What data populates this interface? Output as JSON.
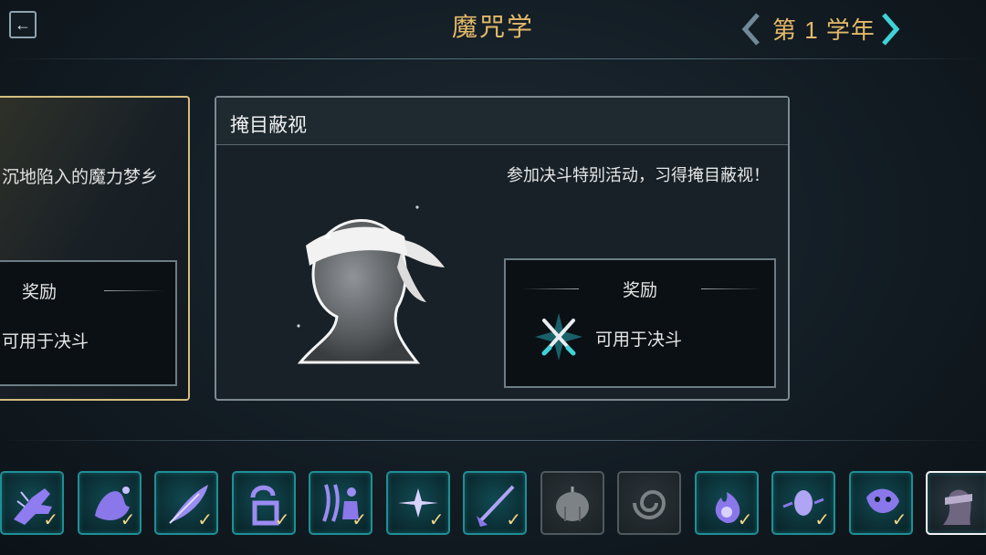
{
  "header": {
    "title": "魔咒学",
    "year_label": "第 1 学年"
  },
  "left_card": {
    "description": "沉地陷入的魔力梦乡",
    "reward_title": "奖励",
    "reward_item": "可用于决斗"
  },
  "main_card": {
    "title": "掩目蔽视",
    "description": "参加决斗特别活动，习得掩目蔽视！",
    "reward_title": "奖励",
    "reward_item": "可用于决斗"
  },
  "spells": [
    {
      "icon": "hand-spell-icon",
      "state": "learned",
      "check": "✓"
    },
    {
      "icon": "splash-spell-icon",
      "state": "learned",
      "check": "✓"
    },
    {
      "icon": "feather-spell-icon",
      "state": "learned",
      "check": "✓"
    },
    {
      "icon": "unlock-spell-icon",
      "state": "learned",
      "check": "✓"
    },
    {
      "icon": "stun-spell-icon",
      "state": "learned",
      "check": "✓"
    },
    {
      "icon": "light-spell-icon",
      "state": "learned",
      "check": "✓"
    },
    {
      "icon": "broom-spell-icon",
      "state": "learned",
      "check": "✓"
    },
    {
      "icon": "pumpkin-spell-icon",
      "state": "locked",
      "check": ""
    },
    {
      "icon": "vortex-spell-icon",
      "state": "locked",
      "check": ""
    },
    {
      "icon": "fire-spell-icon",
      "state": "learned",
      "check": "✓"
    },
    {
      "icon": "shield-spell-icon",
      "state": "learned",
      "check": "✓"
    },
    {
      "icon": "mask-spell-icon",
      "state": "learned",
      "check": "✓"
    },
    {
      "icon": "blindfold-spell-icon",
      "state": "selected",
      "check": ""
    }
  ],
  "colors": {
    "accent_gold": "#e3b96a",
    "tile_teal": "#1f8f95",
    "arrow_cyan": "#3fd3d8"
  }
}
